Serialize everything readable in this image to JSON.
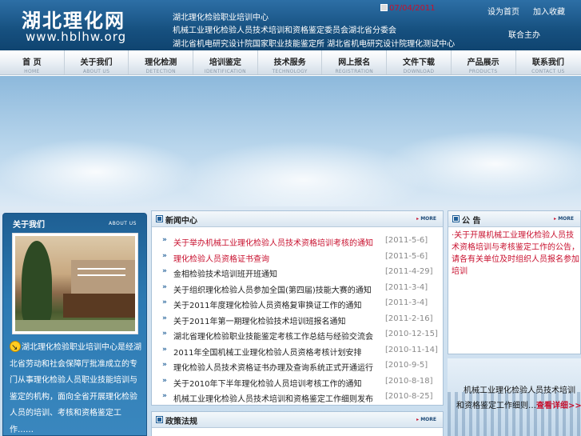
{
  "header": {
    "logo_cn": "湖北理化网",
    "logo_en": "www.hblhw.org",
    "lines": [
      "湖北理化检验职业培训中心",
      "机械工业理化检验人员技术培训和资格鉴定委员会湖北省分委会",
      "湖北省机电研究设计院国家职业技能鉴定所  湖北省机电研究设计院理化测试中心"
    ],
    "date": "07/04/2011",
    "link_home": "设为首页",
    "link_fav": "加入收藏",
    "partner": "联合主办"
  },
  "nav": [
    {
      "cn": "首  页",
      "en": "HOME"
    },
    {
      "cn": "关于我们",
      "en": "ABOUT US"
    },
    {
      "cn": "理化检测",
      "en": "DETECTION"
    },
    {
      "cn": "培训鉴定",
      "en": "IDENTIFICATION"
    },
    {
      "cn": "技术服务",
      "en": "TECHNOLOGY"
    },
    {
      "cn": "网上报名",
      "en": "REGISTRATION"
    },
    {
      "cn": "文件下载",
      "en": "DOWNLOAD"
    },
    {
      "cn": "产品展示",
      "en": "PRODUCTS"
    },
    {
      "cn": "联系我们",
      "en": "CONTACT US"
    }
  ],
  "about": {
    "title": "关于我们",
    "more": "ABOUT US",
    "text": "湖北理化检验职业培训中心是经湖北省劳动和社会保障厅批准成立的专门从事理化检验人员职业技能培训与鉴定的机构，面向全省开展理化检验人员的培训、考核和资格鉴定工作……"
  },
  "news": {
    "title": "新闻中心",
    "more": "MORE",
    "items": [
      {
        "title": "关于举办机械工业理化检验人员技术资格培训考核的通知",
        "date": "[2011-5-6]",
        "red": true
      },
      {
        "title": "理化检验人员资格证书查询",
        "date": "[2011-5-6]",
        "red": true
      },
      {
        "title": "金相检验技术培训班开班通知",
        "date": "[2011-4-29]",
        "red": false
      },
      {
        "title": "关于组织理化检验人员参加全国(第四届)技能大赛的通知",
        "date": "[2011-3-4]",
        "red": false
      },
      {
        "title": "关于2011年度理化检验人员资格复审换证工作的通知",
        "date": "[2011-3-4]",
        "red": false
      },
      {
        "title": "关于2011年第一期理化检验技术培训班报名通知",
        "date": "[2011-2-16]",
        "red": false
      },
      {
        "title": "湖北省理化检验职业技能鉴定考核工作总结与经验交流会",
        "date": "[2010-12-15]",
        "red": false
      },
      {
        "title": "2011年全国机械工业理化检验人员资格考核计划安排",
        "date": "[2010-11-14]",
        "red": false
      },
      {
        "title": "理化检验人员技术资格证书办理及查询系统正式开通运行",
        "date": "[2010-9-5]",
        "red": false
      },
      {
        "title": "关于2010年下半年理化检验人员培训考核工作的通知",
        "date": "[2010-8-18]",
        "red": false
      },
      {
        "title": "机械工业理化检验人员技术培训和资格鉴定工作细则发布",
        "date": "[2010-8-25]",
        "red": false
      }
    ]
  },
  "section2": {
    "title": "政策法规",
    "more": "MORE"
  },
  "notice": {
    "title": "公 告",
    "more": "MORE",
    "text": "·关于开展机械工业理化检验人员技术资格培训与考核鉴定工作的公告，请各有关单位及时组织人员报名参加培训"
  },
  "right_banner": {
    "line1": "机械工业理化检验人员技术培训",
    "line2": "和资格鉴定工作细则…",
    "link": "查看详细>>"
  }
}
